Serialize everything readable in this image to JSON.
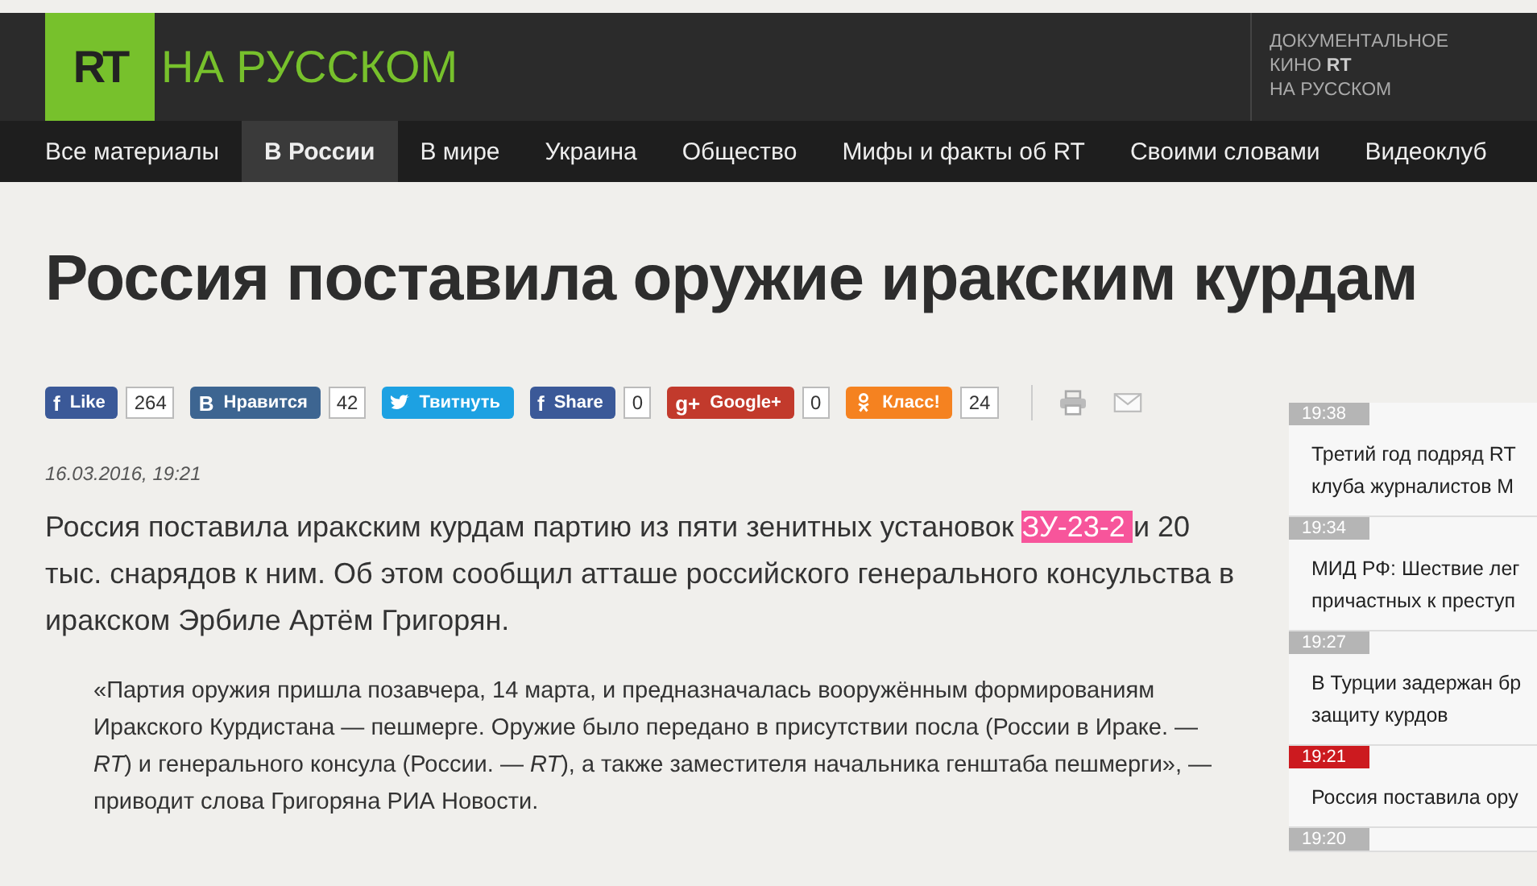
{
  "header": {
    "logo": "RT",
    "site_name": "НА РУССКОМ",
    "promo": {
      "line1": "ДОКУМЕНТАЛЬНОЕ",
      "line2": "КИНО",
      "logo": "RT",
      "line3": "НА РУССКОМ"
    }
  },
  "nav": [
    {
      "label": "Все материалы",
      "selected": false
    },
    {
      "label": "В России",
      "selected": true
    },
    {
      "label": "В мире",
      "selected": false
    },
    {
      "label": "Украина",
      "selected": false
    },
    {
      "label": "Общество",
      "selected": false
    },
    {
      "label": "Мифы и факты об RT",
      "selected": false
    },
    {
      "label": "Своими словами",
      "selected": false
    },
    {
      "label": "Видеоклуб",
      "selected": false
    }
  ],
  "article": {
    "title": "Россия поставила оружие иракским курдам",
    "share": [
      {
        "kind": "glyph",
        "icon": "f",
        "label": "Like",
        "count": "264",
        "color": "#3b5998"
      },
      {
        "kind": "glyph",
        "icon": "B",
        "label": "Нравится",
        "count": "42",
        "color": "#3d6591"
      },
      {
        "kind": "bird",
        "label": "Твитнуть",
        "color": "#1da1e2"
      },
      {
        "kind": "glyph",
        "icon": "f",
        "label": "Share",
        "count": "0",
        "color": "#3b5998"
      },
      {
        "kind": "glyph",
        "icon": "g+",
        "label": "Google+",
        "count": "0",
        "color": "#c23a2c"
      },
      {
        "kind": "person",
        "label": "Класс!",
        "count": "24",
        "color": "#f58220"
      }
    ],
    "date": "16.03.2016, 19:21",
    "lead": [
      {
        "text": "Россия поставила иракским курдам партию из пяти зенитных установок ",
        "highlighted": false
      },
      {
        "text": "ЗУ-23-2 ",
        "highlighted": true
      },
      {
        "text": "и 20 тыс. снарядов к ним. Об этом сообщил атташе российского генерального консульства в иракском Эрбиле Артём Григорян.",
        "highlighted": false
      }
    ],
    "quote": "«Партия оружия пришла позавчера, 14 марта, и предназначалась вооружённым формированиям Иракского Курдистана — пешмерге. Оружие было передано в присутствии посла (России в Ираке. — *RT*) и генерального консула (России. — *RT*), а также заместителя начальника генштаба пешмерги», — приводит слова Григоряна РИА Новости."
  },
  "news_feed": [
    {
      "time": "19:38",
      "lines": [
        "Третий год подряд RT",
        "клуба журналистов М"
      ],
      "selected": false
    },
    {
      "time": "19:34",
      "lines": [
        "МИД РФ: Шествие лег",
        "причастных к преступ"
      ],
      "selected": false
    },
    {
      "time": "19:27",
      "lines": [
        "В Турции задержан бр",
        "защиту курдов"
      ],
      "selected": false
    },
    {
      "time": "19:21",
      "lines": [
        "Россия поставила ору"
      ],
      "selected": true
    },
    {
      "time": "19:20",
      "selected": false
    }
  ]
}
